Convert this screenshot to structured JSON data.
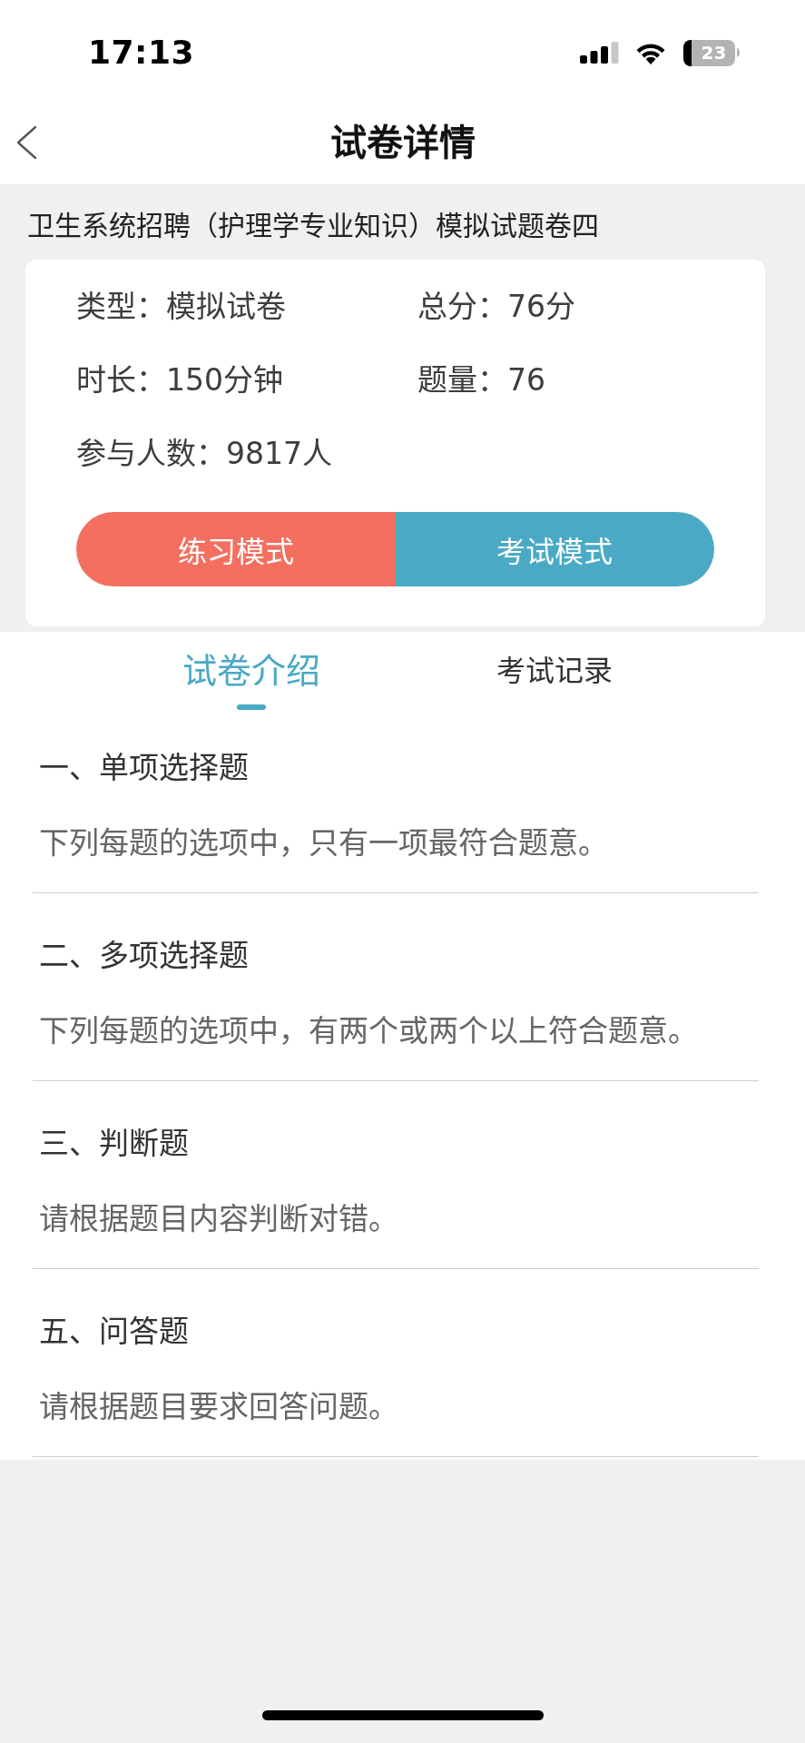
{
  "status_bar": {
    "time": "17:13",
    "battery": "23"
  },
  "nav": {
    "title": "试卷详情"
  },
  "paper": {
    "title": "卫生系统招聘（护理学专业知识）模拟试题卷四",
    "info": [
      {
        "label": "类型：",
        "value": "模拟试卷"
      },
      {
        "label": "总分：",
        "value": "76分"
      },
      {
        "label": "时长：",
        "value": "150分钟"
      },
      {
        "label": "题量：",
        "value": "76"
      },
      {
        "label": "参与人数：",
        "value": "9817人"
      }
    ],
    "modes": [
      {
        "label": "练习模式",
        "color": "#f46f5f"
      },
      {
        "label": "考试模式",
        "color": "#4aaac6"
      }
    ]
  },
  "tabs": [
    {
      "label": "试卷介绍",
      "selected": true
    },
    {
      "label": "考试记录",
      "selected": false
    }
  ],
  "sections": [
    {
      "heading": "一、单项选择题",
      "description": "下列每题的选项中，只有一项最符合题意。"
    },
    {
      "heading": "二、多项选择题",
      "description": "下列每题的选项中，有两个或两个以上符合题意。"
    },
    {
      "heading": "三、判断题",
      "description": "请根据题目内容判断对错。"
    },
    {
      "heading": "五、问答题",
      "description": "请根据题目要求回答问题。"
    }
  ]
}
